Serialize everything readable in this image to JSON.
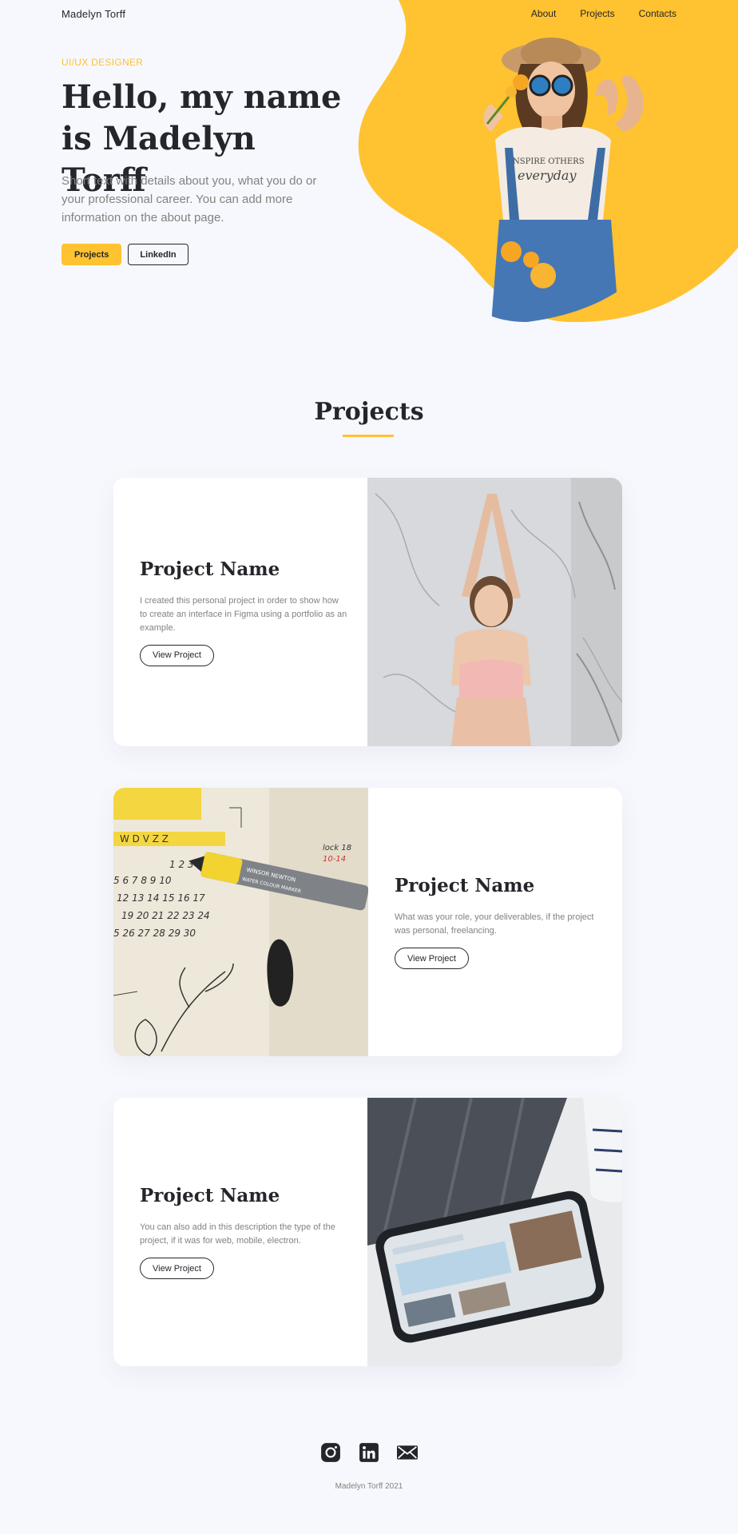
{
  "nav": {
    "brand": "Madelyn Torff",
    "links": [
      "About",
      "Projects",
      "Contacts"
    ]
  },
  "hero": {
    "eyebrow": "UI/UX DESIGNER",
    "title_line1": "Hello,  my name",
    "title_line2": "is Madelyn Torff",
    "text": "Short text with details about you, what you do or your professional career. You can add more information on the about page.",
    "buttons": {
      "primary": "Projects",
      "secondary": "LinkedIn"
    },
    "photo_shirt_line1": "NSPIRE OTHERS",
    "photo_shirt_line2": "everyday"
  },
  "projects": {
    "title": "Projects",
    "items": [
      {
        "title": "Project Name",
        "description": "I created this personal project in order to show how to create an interface in Figma using a portfolio as an example.",
        "button": "View Project"
      },
      {
        "title": "Project Name",
        "description": "What was your role, your deliverables, if the project was personal, freelancing.",
        "button": "View Project"
      },
      {
        "title": "Project Name",
        "description": "You can also add in this description the type of the project, if it was for web, mobile, electron.",
        "button": "View Project"
      }
    ]
  },
  "calendar": {
    "header": "W D V Z Z",
    "rows": [
      "1  2  3",
      "5  6  7  8  9  10",
      "12  13  14  15  16  17",
      "19  20  21  22  23  24",
      "5  26  27  28  29  30"
    ],
    "note_line1": "lock 18",
    "note_line2": "10-14",
    "marker_brand": "WINSOR NEWTON",
    "marker_label": "WATER COLOUR MARKER"
  },
  "footer": {
    "icons": [
      "instagram-icon",
      "linkedin-icon",
      "mail-icon"
    ],
    "copyright": "Madelyn Torff 2021"
  },
  "colors": {
    "accent": "#ffc230",
    "text": "#25262b",
    "muted": "#828282",
    "background": "#f7f8fd"
  }
}
